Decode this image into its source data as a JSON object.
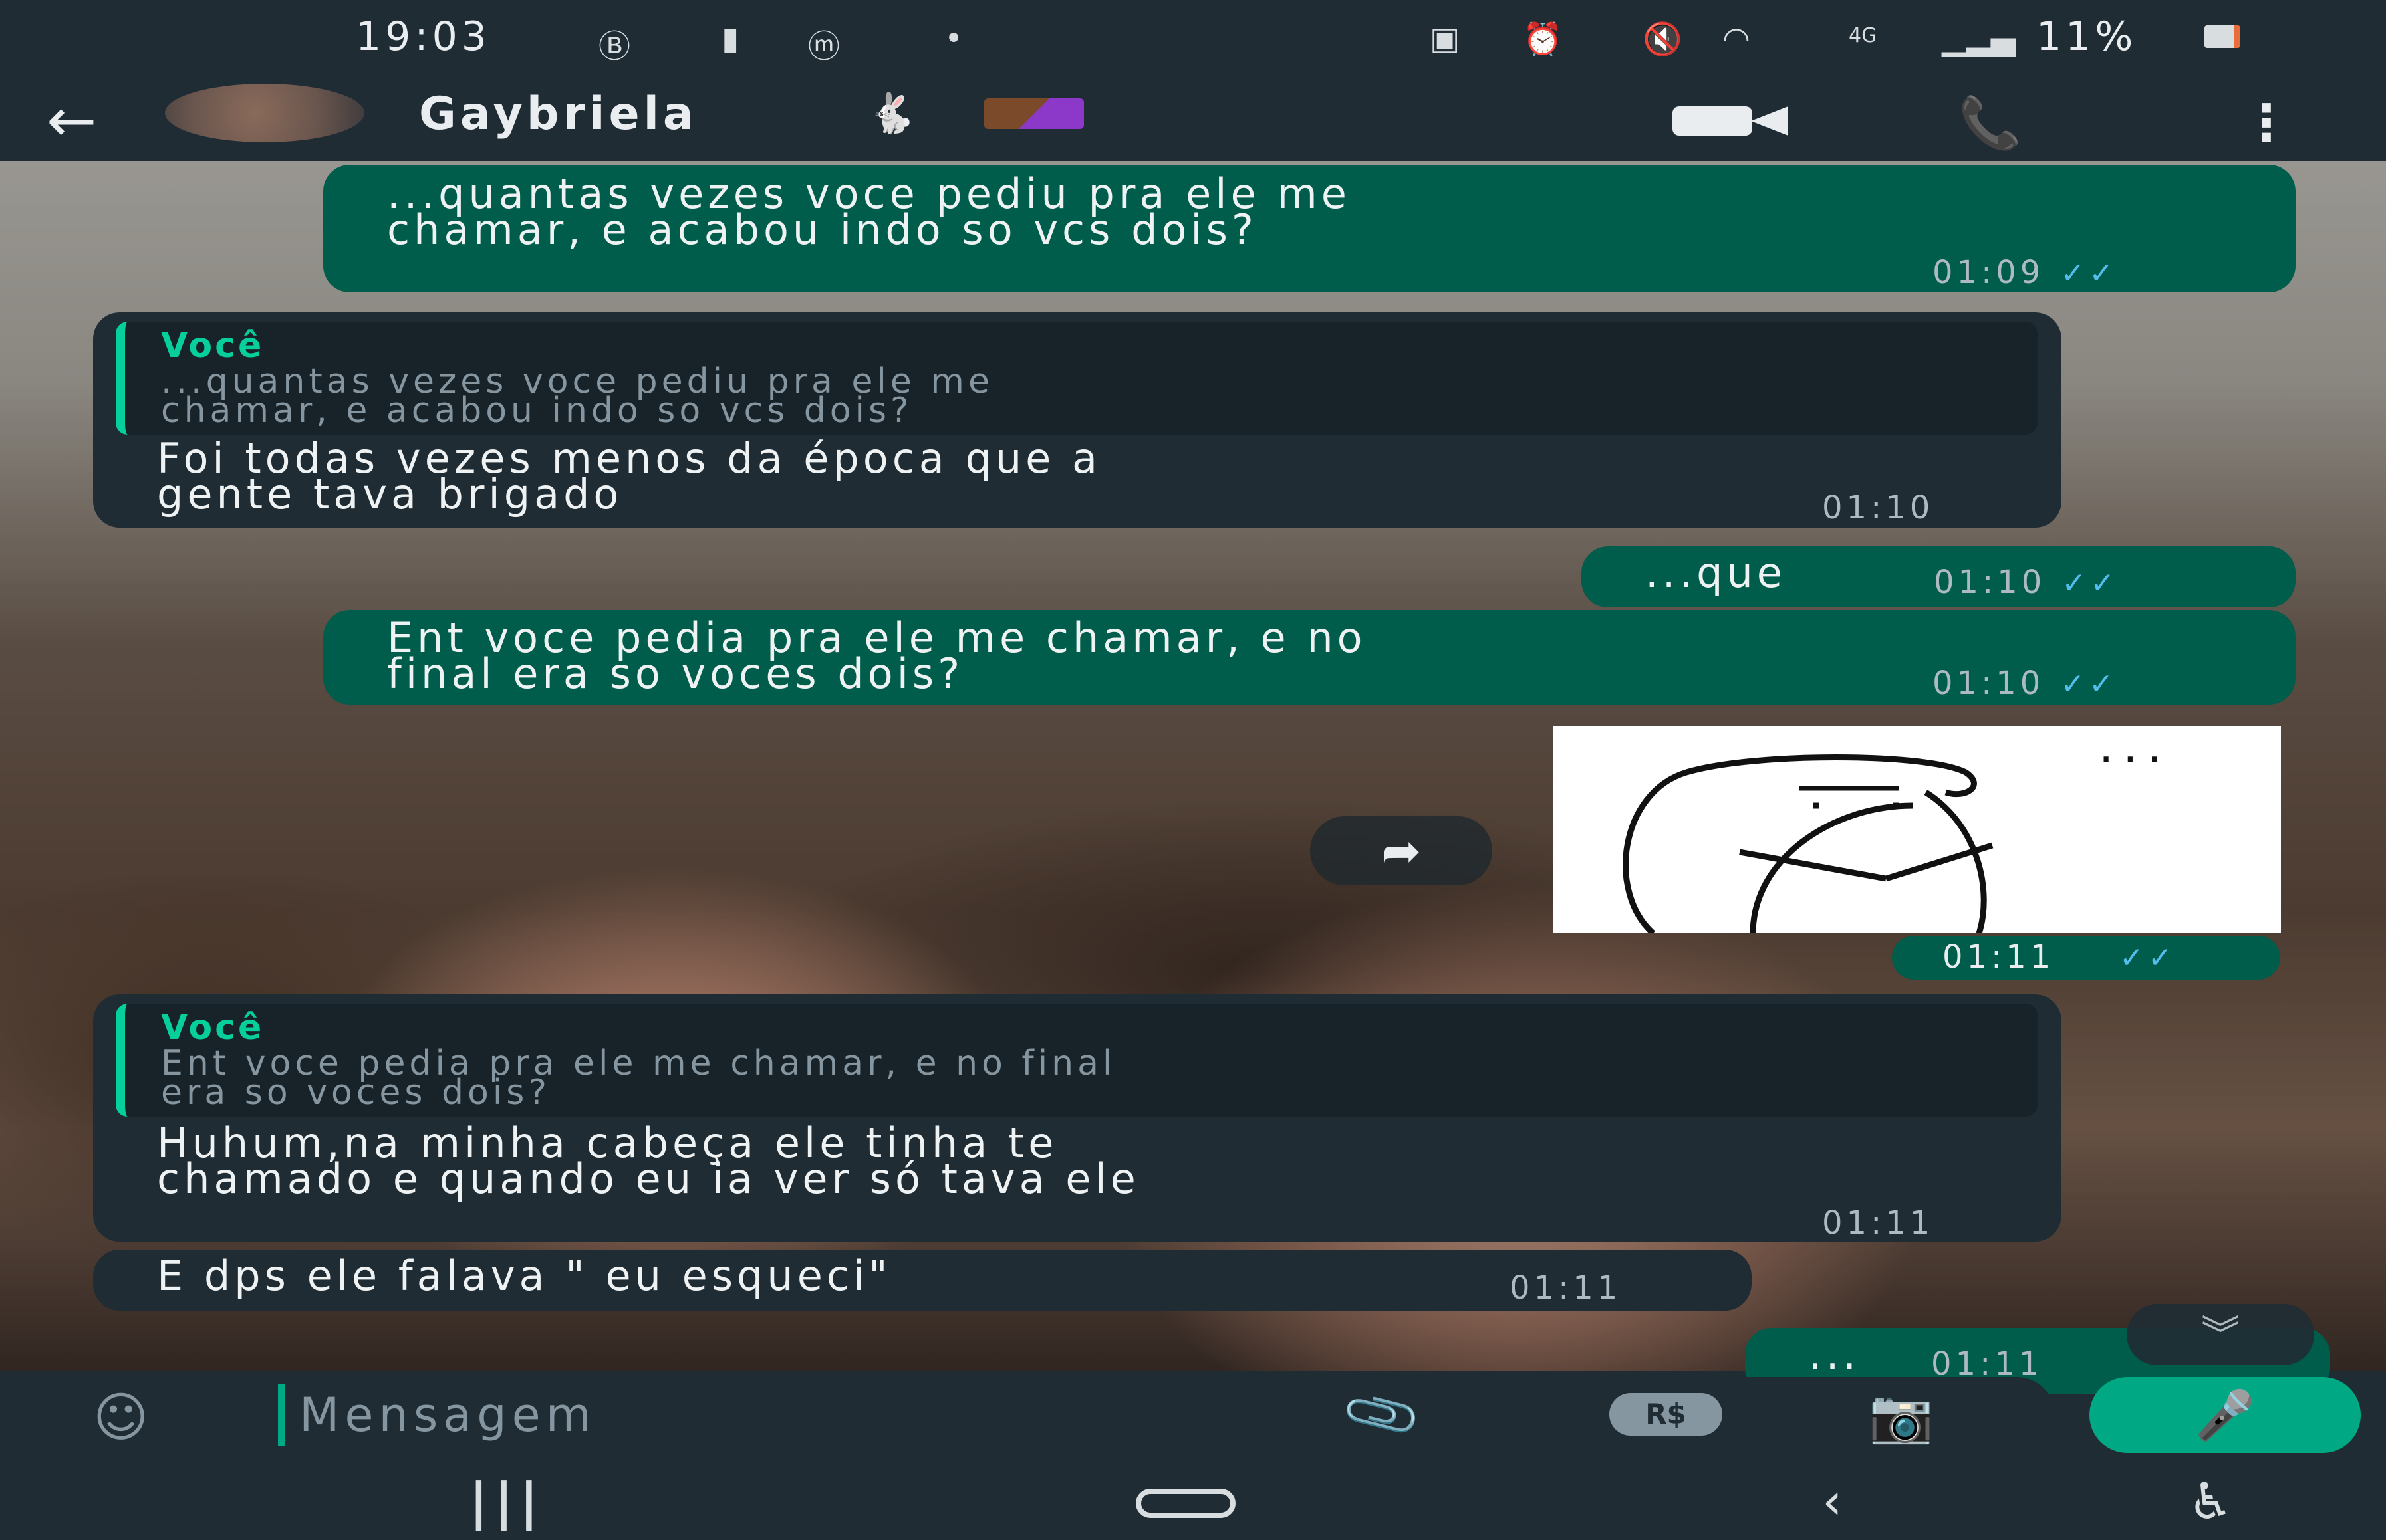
{
  "status_bar": {
    "time": "19:03",
    "battery_percent": "11%",
    "left_icons": [
      "b-circle-icon",
      "battery-saver-icon",
      "m-icon",
      "dot-icon"
    ],
    "right_icons": [
      "screenshot-icon",
      "alarm-icon",
      "mute-icon",
      "wifi-icon",
      "4g-icon",
      "signal-icon",
      "battery-icon"
    ],
    "network_label": "4G"
  },
  "header": {
    "contact_name": "Gaybriela",
    "back_icon": "arrow-left-icon",
    "video_icon": "video-camera-icon",
    "call_icon": "phone-icon",
    "menu_icon": "more-vertical-icon"
  },
  "messages": [
    {
      "direction": "out",
      "text_lines": [
        "...quantas vezes voce pediu pra ele me",
        "chamar, e acabou indo so vcs dois?"
      ],
      "time": "01:09",
      "ticks": "✓✓"
    },
    {
      "direction": "in",
      "quote": {
        "author": "Você",
        "text_lines": [
          "...quantas vezes voce pediu pra ele me",
          "chamar, e acabou indo so vcs dois?"
        ]
      },
      "text_lines": [
        "Foi todas vezes menos da época que a",
        "gente tava brigado"
      ],
      "time": "01:10"
    },
    {
      "direction": "out",
      "text_lines": [
        "...que"
      ],
      "time": "01:10",
      "ticks": "✓✓"
    },
    {
      "direction": "out",
      "text_lines": [
        "Ent voce pedia pra ele me chamar, e no",
        "final era so voces dois?"
      ],
      "time": "01:10",
      "ticks": "✓✓"
    },
    {
      "direction": "out",
      "type": "sticker",
      "sticker_description": "flork-clock-sticker",
      "sticker_text": "...",
      "time": "01:11",
      "ticks": "✓✓"
    },
    {
      "direction": "in",
      "quote": {
        "author": "Você",
        "text_lines": [
          "Ent voce pedia pra ele me chamar, e no final",
          "era so voces dois?"
        ]
      },
      "text_lines": [
        "Huhum,na minha cabeça ele tinha te",
        "chamado e quando eu ia ver só tava ele"
      ],
      "time": "01:11"
    },
    {
      "direction": "in",
      "text_lines": [
        "E dps ele falava \" eu esqueci\""
      ],
      "time": "01:11"
    },
    {
      "direction": "out",
      "text_lines": [
        "..."
      ],
      "time": "01:11",
      "partial": true
    }
  ],
  "input_bar": {
    "placeholder": "Mensagem",
    "emoji_icon": "emoji-smile-icon",
    "attach_icon": "paperclip-icon",
    "payment_label": "R$",
    "camera_icon": "camera-icon",
    "mic_icon": "microphone-icon"
  },
  "scroll_down_icon": "double-chevron-down-icon",
  "forward_icon": "forward-arrow-icon",
  "nav_bar": {
    "recents_icon": "recent-apps-icon",
    "home_icon": "home-icon",
    "back_icon": "nav-back-icon",
    "accessibility_icon": "accessibility-icon"
  },
  "colors": {
    "outgoing_bubble": "#005c4b",
    "incoming_bubble": "#1f2c34",
    "accent": "#00a884",
    "quote_author": "#06cf9c",
    "read_ticks": "#53bdeb"
  }
}
